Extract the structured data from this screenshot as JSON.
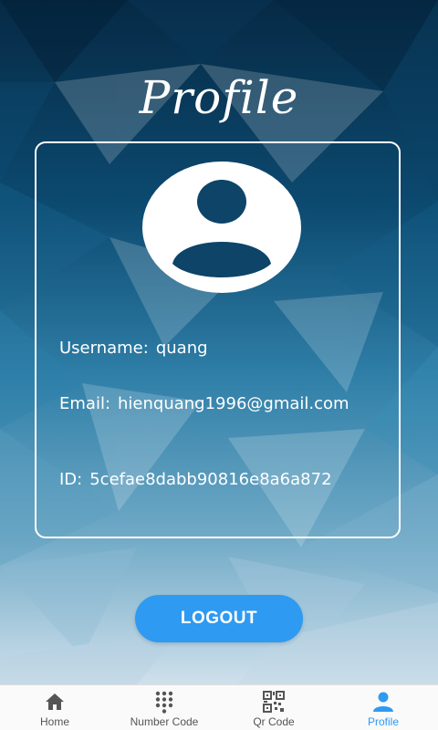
{
  "header": {
    "title": "Profile"
  },
  "profile": {
    "avatar_icon": "user-avatar-icon",
    "username_label": "Username:",
    "username": "quang",
    "email_label": "Email:",
    "email": "hienquang1996@gmail.com",
    "id_label": "ID:",
    "id": "5cefae8dabb90816e8a6a872"
  },
  "actions": {
    "logout_label": "LOGOUT"
  },
  "bottom_nav": {
    "active": "Profile",
    "items": [
      {
        "label": "Home",
        "icon": "home-icon"
      },
      {
        "label": "Number Code",
        "icon": "dialpad-icon"
      },
      {
        "label": "Qr Code",
        "icon": "qr-code-icon"
      },
      {
        "label": "Profile",
        "icon": "person-icon"
      }
    ]
  },
  "colors": {
    "accent": "#2e9af2",
    "background_top": "#062a45",
    "background_bottom": "#c9dbe8",
    "nav_inactive": "#555555"
  }
}
